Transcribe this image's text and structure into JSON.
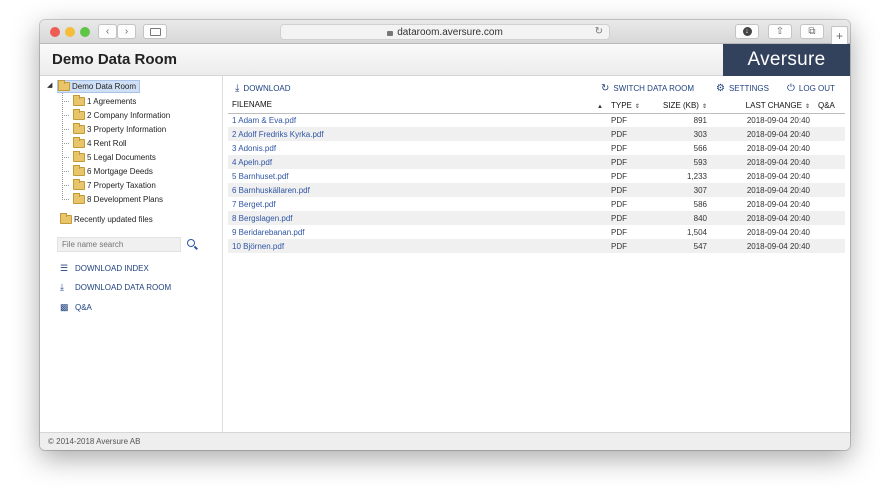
{
  "browser": {
    "url": "dataroom.aversure.com",
    "traffic_lights": {
      "close": "#ee5c53",
      "minimize": "#f5bd3a",
      "zoom": "#5fc447"
    }
  },
  "header": {
    "title": "Demo Data Room",
    "logo": "Aversure",
    "logo_bg": "#32415c"
  },
  "sidebar": {
    "root": "Demo Data Room",
    "folders": [
      "1 Agreements",
      "2 Company Information",
      "3 Property Information",
      "4 Rent Roll",
      "5 Legal Documents",
      "6 Mortgage Deeds",
      "7 Property Taxation",
      "8 Development Plans"
    ],
    "recent": "Recently updated files",
    "search_placeholder": "File name search",
    "links": {
      "download_index": "DOWNLOAD INDEX",
      "download_data_room": "DOWNLOAD DATA ROOM",
      "qa": "Q&A"
    }
  },
  "actions": {
    "download": "DOWNLOAD",
    "switch": "SWITCH DATA ROOM",
    "settings": "SETTINGS",
    "logout": "LOG OUT"
  },
  "table": {
    "headers": {
      "filename": "FILENAME",
      "type": "TYPE",
      "size": "SIZE (KB)",
      "last_change": "LAST CHANGE",
      "qa": "Q&A"
    },
    "rows": [
      {
        "name": "1 Adam & Eva.pdf",
        "type": "PDF",
        "size": "891",
        "date": "2018-09-04 20:40"
      },
      {
        "name": "2 Adolf Fredriks Kyrka.pdf",
        "type": "PDF",
        "size": "303",
        "date": "2018-09-04 20:40"
      },
      {
        "name": "3 Adonis.pdf",
        "type": "PDF",
        "size": "566",
        "date": "2018-09-04 20:40"
      },
      {
        "name": "4 Apeln.pdf",
        "type": "PDF",
        "size": "593",
        "date": "2018-09-04 20:40"
      },
      {
        "name": "5 Barnhuset.pdf",
        "type": "PDF",
        "size": "1,233",
        "date": "2018-09-04 20:40"
      },
      {
        "name": "6 Barnhuskällaren.pdf",
        "type": "PDF",
        "size": "307",
        "date": "2018-09-04 20:40"
      },
      {
        "name": "7 Berget.pdf",
        "type": "PDF",
        "size": "586",
        "date": "2018-09-04 20:40"
      },
      {
        "name": "8 Bergslagen.pdf",
        "type": "PDF",
        "size": "840",
        "date": "2018-09-04 20:40"
      },
      {
        "name": "9 Beridarebanan.pdf",
        "type": "PDF",
        "size": "1,504",
        "date": "2018-09-04 20:40"
      },
      {
        "name": "10 Björnen.pdf",
        "type": "PDF",
        "size": "547",
        "date": "2018-09-04 20:40"
      }
    ]
  },
  "footer": "© 2014-2018 Aversure AB"
}
